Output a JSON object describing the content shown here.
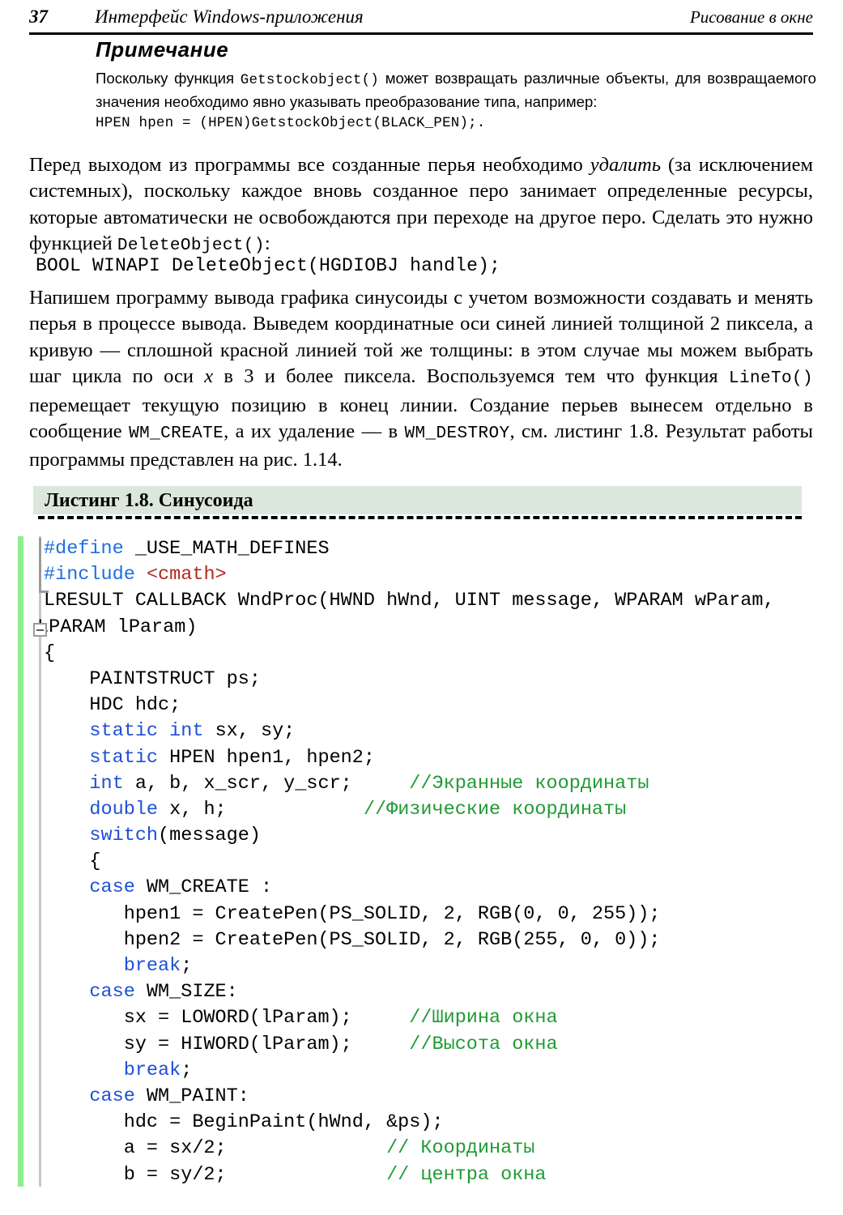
{
  "header": {
    "page_number": "37",
    "chapter_title": "Интерфейс Windows-приложения",
    "section_title": "Рисование в окне"
  },
  "note": {
    "title": "Примечание",
    "body_part1": "Поскольку функция ",
    "body_code1": "Getstockobject()",
    "body_part2": " может возвращать различные объекты, для возвращаемого значения необходимо явно указывать преобразование типа, например:",
    "code_line": "HPEN hpen = (HPEN)GetstockObject(BLACK_PEN);."
  },
  "paragraphs": {
    "p1_a": "Перед выходом из программы все созданные перья необходимо ",
    "p1_italic": "удалить",
    "p1_b": " (за исключением системных), поскольку каждое вновь созданное перо занимает определенные ресурсы, которые автоматически не освобождаются при переходе на другое перо. Сделать это нужно функцией ",
    "p1_code": "DeleteObject()",
    "p1_c": ":",
    "code_block": "BOOL WINAPI DeleteObject(HGDIOBJ handle);",
    "p2_a": "Напишем программу вывода графика синусоиды с учетом возможности создавать и менять перья в процессе вывода. Выведем координатные оси синей линией толщиной 2 пиксела, а кривую — сплошной красной линией той же толщины: в этом случае мы можем выбрать шаг цикла по оси ",
    "p2_x": "x",
    "p2_b": " в 3 и более пиксела. Воспользуемся тем что функция ",
    "p2_code1": "LineTo()",
    "p2_c": " перемещает текущую позицию в конец линии. Создание перьев вынесем отдельно в сообщение ",
    "p2_code2": "WM_CREATE",
    "p2_d": ", а их удаление — в ",
    "p2_code3": "WM_DESTROY",
    "p2_e": ", см. листинг 1.8. Результат работы программы представлен на рис. 1.14."
  },
  "listing": {
    "caption": "Листинг 1.8. Синусоида",
    "caption_bg": "#dbe7db",
    "gutter_color": "#90ee90",
    "fold_icon": "collapse-box-icon",
    "colors": {
      "keyword": "#1f4fd8",
      "preprocessor": "#1f6fe0",
      "string": "#b02a1f",
      "comment": "#1f9b33",
      "plain": "#000000"
    },
    "lines": [
      {
        "indent": 0,
        "tokens": [
          {
            "t": "#define",
            "c": "pre"
          },
          {
            "t": " _USE_MATH_DEFINES",
            "c": ""
          }
        ]
      },
      {
        "indent": 0,
        "tokens": [
          {
            "t": "#include",
            "c": "pre"
          },
          {
            "t": " ",
            "c": ""
          },
          {
            "t": "<cmath>",
            "c": "str"
          }
        ]
      },
      {
        "indent": 0,
        "tokens": [
          {
            "t": "LRESULT CALLBACK WndProc(HWND hWnd, UINT message, WPARAM wParam,",
            "c": ""
          }
        ]
      },
      {
        "indent": -1,
        "tokens": [
          {
            "t": "LPARAM lParam)",
            "c": ""
          }
        ]
      },
      {
        "indent": 0,
        "tokens": [
          {
            "t": "{",
            "c": ""
          }
        ]
      },
      {
        "indent": 0,
        "tokens": [
          {
            "t": "    PAINTSTRUCT ps;",
            "c": ""
          }
        ]
      },
      {
        "indent": 0,
        "tokens": [
          {
            "t": "    HDC hdc;",
            "c": ""
          }
        ]
      },
      {
        "indent": 0,
        "tokens": [
          {
            "t": "    ",
            "c": ""
          },
          {
            "t": "static",
            "c": "kw"
          },
          {
            "t": " ",
            "c": ""
          },
          {
            "t": "int",
            "c": "kw"
          },
          {
            "t": " sx, sy;",
            "c": ""
          }
        ]
      },
      {
        "indent": 0,
        "tokens": [
          {
            "t": "    ",
            "c": ""
          },
          {
            "t": "static",
            "c": "kw"
          },
          {
            "t": " HPEN hpen1, hpen2;",
            "c": ""
          }
        ]
      },
      {
        "indent": 0,
        "tokens": [
          {
            "t": "    ",
            "c": ""
          },
          {
            "t": "int",
            "c": "kw"
          },
          {
            "t": " a, b, x_scr, y_scr;     ",
            "c": ""
          },
          {
            "t": "//Экранные координаты",
            "c": "cmt"
          }
        ]
      },
      {
        "indent": 0,
        "tokens": [
          {
            "t": "    ",
            "c": ""
          },
          {
            "t": "double",
            "c": "kw"
          },
          {
            "t": " x, h;            ",
            "c": ""
          },
          {
            "t": "//Физические координаты",
            "c": "cmt"
          }
        ]
      },
      {
        "indent": 0,
        "tokens": [
          {
            "t": "    ",
            "c": ""
          },
          {
            "t": "switch",
            "c": "kw"
          },
          {
            "t": "(message)",
            "c": ""
          }
        ]
      },
      {
        "indent": 0,
        "tokens": [
          {
            "t": "    {",
            "c": ""
          }
        ]
      },
      {
        "indent": 0,
        "tokens": [
          {
            "t": "    ",
            "c": ""
          },
          {
            "t": "case",
            "c": "kw"
          },
          {
            "t": " WM_CREATE :",
            "c": ""
          }
        ]
      },
      {
        "indent": 0,
        "tokens": [
          {
            "t": "       hpen1 = CreatePen(PS_SOLID, 2, RGB(0, 0, 255));",
            "c": ""
          }
        ]
      },
      {
        "indent": 0,
        "tokens": [
          {
            "t": "       hpen2 = CreatePen(PS_SOLID, 2, RGB(255, 0, 0));",
            "c": ""
          }
        ]
      },
      {
        "indent": 0,
        "tokens": [
          {
            "t": "       ",
            "c": ""
          },
          {
            "t": "break",
            "c": "kw"
          },
          {
            "t": ";",
            "c": ""
          }
        ]
      },
      {
        "indent": 0,
        "tokens": [
          {
            "t": "    ",
            "c": ""
          },
          {
            "t": "case",
            "c": "kw"
          },
          {
            "t": " WM_SIZE:",
            "c": ""
          }
        ]
      },
      {
        "indent": 0,
        "tokens": [
          {
            "t": "       sx = LOWORD(lParam);     ",
            "c": ""
          },
          {
            "t": "//Ширина окна",
            "c": "cmt"
          }
        ]
      },
      {
        "indent": 0,
        "tokens": [
          {
            "t": "       sy = HIWORD(lParam);     ",
            "c": ""
          },
          {
            "t": "//Высота окна",
            "c": "cmt"
          }
        ]
      },
      {
        "indent": 0,
        "tokens": [
          {
            "t": "       ",
            "c": ""
          },
          {
            "t": "break",
            "c": "kw"
          },
          {
            "t": ";",
            "c": ""
          }
        ]
      },
      {
        "indent": 0,
        "tokens": [
          {
            "t": "    ",
            "c": ""
          },
          {
            "t": "case",
            "c": "kw"
          },
          {
            "t": " WM_PAINT:",
            "c": ""
          }
        ]
      },
      {
        "indent": 0,
        "tokens": [
          {
            "t": "       hdc = BeginPaint(hWnd, &ps);",
            "c": ""
          }
        ]
      },
      {
        "indent": 0,
        "tokens": [
          {
            "t": "       a = sx/2;              ",
            "c": ""
          },
          {
            "t": "// Координаты",
            "c": "cmt"
          }
        ]
      },
      {
        "indent": 0,
        "tokens": [
          {
            "t": "       b = sy/2;              ",
            "c": ""
          },
          {
            "t": "// центра окна",
            "c": "cmt"
          }
        ]
      }
    ]
  }
}
